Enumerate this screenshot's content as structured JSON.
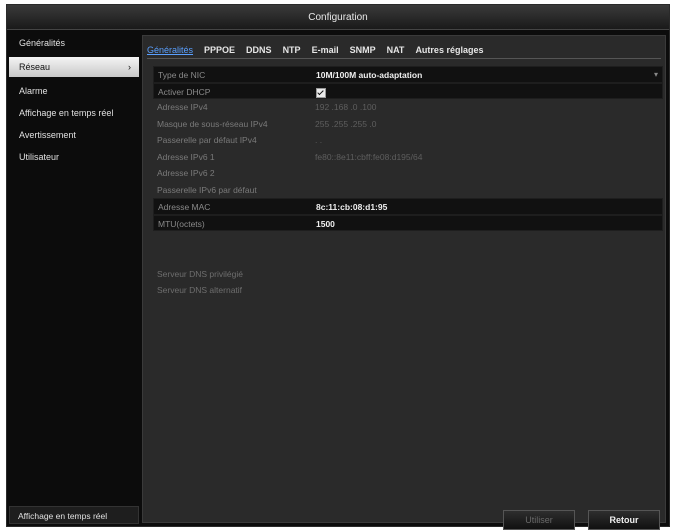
{
  "window": {
    "title": "Configuration"
  },
  "sidebar": {
    "items": [
      {
        "label": "Généralités",
        "active": false
      },
      {
        "label": "Réseau",
        "active": true
      },
      {
        "label": "Alarme",
        "active": false
      },
      {
        "label": "Affichage en temps réel",
        "active": false
      },
      {
        "label": "Avertissement",
        "active": false
      },
      {
        "label": "Utilisateur",
        "active": false
      }
    ],
    "chevron": "›",
    "footer": "Affichage en temps réel"
  },
  "tabs": [
    {
      "label": "Généralités",
      "active": true
    },
    {
      "label": "PPPOE"
    },
    {
      "label": "DDNS"
    },
    {
      "label": "NTP"
    },
    {
      "label": "E-mail"
    },
    {
      "label": "SNMP"
    },
    {
      "label": "NAT"
    },
    {
      "label": "Autres réglages"
    }
  ],
  "form": {
    "nic_type": {
      "label": "Type de NIC",
      "value": "10M/100M auto-adaptation",
      "dropdown_icon": "▾"
    },
    "dhcp": {
      "label": "Activer DHCP",
      "checked": true
    },
    "ipv4": {
      "label": "Adresse IPv4",
      "value": "192 .168 .0    .100"
    },
    "mask": {
      "label": "Masque de sous-réseau IPv4",
      "value": "255 .255 .255 .0"
    },
    "gateway4": {
      "label": "Passerelle par défaut IPv4",
      "value": ".          ."
    },
    "ipv6_1": {
      "label": "Adresse IPv6 1",
      "value": "fe80::8e11:cbff:fe08:d195/64"
    },
    "ipv6_2": {
      "label": "Adresse IPv6 2",
      "value": ""
    },
    "gateway6": {
      "label": "Passerelle IPv6 par défaut",
      "value": ""
    },
    "mac": {
      "label": "Adresse MAC",
      "value": "8c:11:cb:08:d1:95"
    },
    "mtu": {
      "label": "MTU(octets)",
      "value": "1500"
    }
  },
  "dns": {
    "preferred": "Serveur DNS privilégié",
    "alternate": "Serveur DNS alternatif"
  },
  "buttons": {
    "apply": "Utiliser",
    "back": "Retour"
  }
}
